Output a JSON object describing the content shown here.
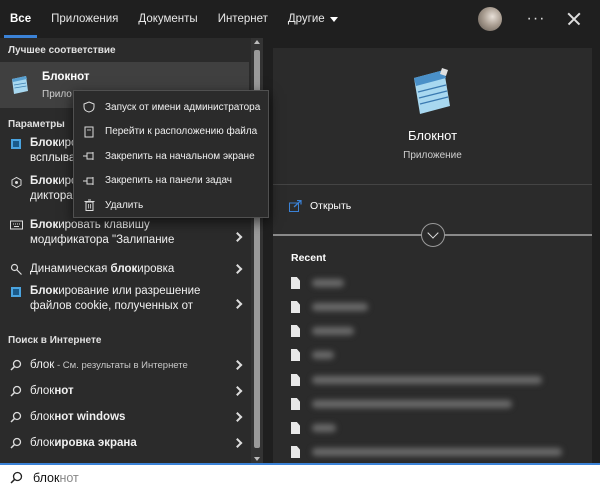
{
  "tabs": [
    {
      "label": "Все",
      "active": true
    },
    {
      "label": "Приложения"
    },
    {
      "label": "Документы"
    },
    {
      "label": "Интернет"
    },
    {
      "label": "Другие"
    }
  ],
  "best_match": {
    "section": "Лучшее соответствие",
    "name": "Блокнот",
    "type_partial": "Прило"
  },
  "settings": {
    "section": "Параметры",
    "items": [
      {
        "bold": "Блок",
        "rest1": "иров",
        "line2": "всплыва"
      },
      {
        "bold": "Блок",
        "rest1": "иров",
        "line2": "диктора"
      },
      {
        "bold": "Блок",
        "rest1": "ировать клавишу",
        "line2": "модификатора \"Залипание"
      },
      {
        "bold": "блок",
        "pre": "Динамическая ",
        "rest1": "ировка"
      },
      {
        "bold": "Блок",
        "rest1": "ирование или разрешение",
        "line2": "файлов cookie, полученных от"
      }
    ]
  },
  "web": {
    "section": "Поиск в Интернете",
    "items": [
      {
        "text": "блок",
        "hint": " - См. результаты в Интернете"
      },
      {
        "plain": "блок",
        "bold": "нот"
      },
      {
        "plain": "блок",
        "bold": "нот windows"
      },
      {
        "plain": "блок",
        "bold": "ировка экрана"
      }
    ]
  },
  "context_menu": [
    {
      "label": "Запуск от имени администратора",
      "icon": "shield-icon"
    },
    {
      "label": "Перейти к расположению файла",
      "icon": "file-location-icon"
    },
    {
      "label": "Закрепить на начальном экране",
      "icon": "pin-icon"
    },
    {
      "label": "Закрепить на панели задач",
      "icon": "pin-taskbar-icon"
    },
    {
      "label": "Удалить",
      "icon": "trash-icon"
    }
  ],
  "details": {
    "name": "Блокнот",
    "type": "Приложение",
    "open_label": "Открыть",
    "recent_title": "Recent"
  },
  "search": {
    "typed": "блок",
    "suggestion": "нот"
  },
  "colors": {
    "accent": "#3b82d6"
  }
}
